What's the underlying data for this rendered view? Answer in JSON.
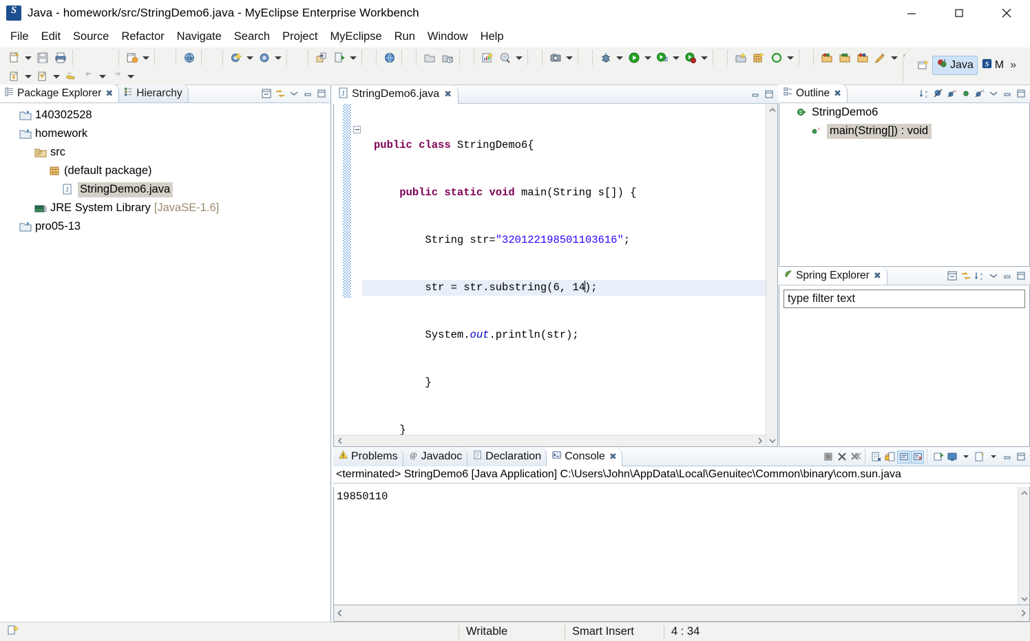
{
  "window": {
    "title": "Java - homework/src/StringDemo6.java - MyEclipse Enterprise Workbench",
    "app_icon": "myeclipse-logo-icon",
    "minimize": "minimize-icon",
    "maximize": "maximize-icon",
    "close": "close-icon"
  },
  "menubar": {
    "items": [
      {
        "label": "File"
      },
      {
        "label": "Edit"
      },
      {
        "label": "Source"
      },
      {
        "label": "Refactor"
      },
      {
        "label": "Navigate"
      },
      {
        "label": "Search"
      },
      {
        "label": "Project"
      },
      {
        "label": "MyEclipse"
      },
      {
        "label": "Run"
      },
      {
        "label": "Window"
      },
      {
        "label": "Help"
      }
    ]
  },
  "perspective": {
    "open_perspective_icon": "open-perspective-icon",
    "items": [
      {
        "label": "Java",
        "icon": "java-perspective-icon",
        "active": true
      },
      {
        "label": "M",
        "icon": "myeclipse-perspective-icon",
        "active": false
      }
    ],
    "overflow": "»"
  },
  "package_explorer": {
    "tabs": [
      {
        "label": "Package Explorer",
        "icon": "package-explorer-icon",
        "active": true,
        "closable": true
      },
      {
        "label": "Hierarchy",
        "icon": "hierarchy-icon",
        "active": false,
        "closable": false
      }
    ],
    "tools": [
      "collapse-all-icon",
      "link-with-editor-icon",
      "view-menu-icon",
      "minimize-icon",
      "maximize-icon"
    ],
    "tree": [
      {
        "label": "140302528",
        "icon": "closed-project-icon",
        "indent": 0,
        "selected": false,
        "suffix": ""
      },
      {
        "label": "homework",
        "icon": "closed-project-icon",
        "indent": 0,
        "selected": false,
        "suffix": ""
      },
      {
        "label": "src",
        "icon": "source-folder-icon",
        "indent": 1,
        "selected": false,
        "suffix": ""
      },
      {
        "label": "(default package)",
        "icon": "package-icon",
        "indent": 2,
        "selected": false,
        "suffix": ""
      },
      {
        "label": "StringDemo6.java",
        "icon": "java-file-icon",
        "indent": 3,
        "selected": true,
        "suffix": ""
      },
      {
        "label": "JRE System Library",
        "icon": "library-icon",
        "indent": 1,
        "selected": false,
        "suffix": "[JavaSE-1.6]"
      },
      {
        "label": "pro05-13",
        "icon": "closed-project-icon",
        "indent": 0,
        "selected": false,
        "suffix": ""
      }
    ]
  },
  "editor": {
    "tab": {
      "label": "StringDemo6.java",
      "icon": "java-file-icon",
      "closable": true
    },
    "tools": [
      "minimize-icon",
      "maximize-icon"
    ],
    "lines": [
      [
        {
          "t": "public class ",
          "c": "kw"
        },
        {
          "t": "StringDemo6{",
          "c": "plain"
        }
      ],
      [
        {
          "t": "    ",
          "c": "plain"
        },
        {
          "t": "public static void ",
          "c": "kw"
        },
        {
          "t": "main(String s[]) {",
          "c": "plain"
        }
      ],
      [
        {
          "t": "        String str=",
          "c": "plain"
        },
        {
          "t": "\"320122198501103616\"",
          "c": "str"
        },
        {
          "t": ";",
          "c": "plain"
        }
      ],
      [
        {
          "t": "        str = str.substring(6, 14",
          "c": "plain"
        },
        {
          "t": "|CARET|",
          "c": "caret"
        },
        {
          "t": ");",
          "c": "plain"
        }
      ],
      [
        {
          "t": "        System.",
          "c": "plain"
        },
        {
          "t": "out",
          "c": "fld"
        },
        {
          "t": ".println(str);",
          "c": "plain"
        }
      ],
      [
        {
          "t": "        }",
          "c": "plain"
        }
      ],
      [
        {
          "t": "    }",
          "c": "plain"
        }
      ]
    ],
    "highlighted_line": 3
  },
  "outline": {
    "tab": {
      "label": "Outline",
      "icon": "outline-icon",
      "closable": true
    },
    "tools": [
      "sort-icon",
      "hide-fields-icon",
      "hide-static-icon",
      "hide-nonpublic-icon",
      "hide-local-types-icon",
      "view-menu-icon",
      "minimize-icon",
      "maximize-icon"
    ],
    "tree": [
      {
        "label": "StringDemo6",
        "icon": "class-icon",
        "indent": 0,
        "selected": false
      },
      {
        "label": "main(String[]) : void",
        "icon": "public-static-method-icon",
        "indent": 1,
        "selected": true
      }
    ]
  },
  "spring_explorer": {
    "tab": {
      "label": "Spring Explorer",
      "icon": "spring-leaf-icon",
      "closable": true
    },
    "tools": [
      "collapse-all-icon",
      "link-with-editor-icon",
      "sort-icon",
      "view-menu-icon",
      "minimize-icon",
      "maximize-icon"
    ],
    "filter": {
      "value": "type filter text",
      "placeholder": "type filter text"
    }
  },
  "console": {
    "tabs": [
      {
        "label": "Problems",
        "icon": "problems-icon",
        "active": false,
        "closable": false
      },
      {
        "label": "Javadoc",
        "icon": "javadoc-icon",
        "active": false,
        "closable": false
      },
      {
        "label": "Declaration",
        "icon": "declaration-icon",
        "active": false,
        "closable": false
      },
      {
        "label": "Console",
        "icon": "console-icon",
        "active": true,
        "closable": true
      }
    ],
    "tools": [
      "terminate-icon",
      "remove-launch-icon",
      "remove-all-launches-icon",
      "clear-console-icon",
      "scroll-lock-icon",
      "word-wrap-icon",
      "show-console-on-output-icon",
      "pin-console-icon",
      "display-selected-console-icon",
      "open-console-icon",
      "minimize-icon",
      "maximize-icon"
    ],
    "header": "<terminated> StringDemo6 [Java Application] C:\\Users\\John\\AppData\\Local\\Genuitec\\Common\\binary\\com.sun.java",
    "output": "19850110"
  },
  "statusbar": {
    "left_icon": "new-element-icon",
    "writable": "Writable",
    "insert_mode": "Smart Insert",
    "position": "4 : 34"
  },
  "toolbar": {
    "groups": [
      {
        "row": 1,
        "buttons": [
          {
            "icon": "new-wizard-icon",
            "dropdown": true
          },
          {
            "icon": "save-icon",
            "dropdown": false
          },
          {
            "icon": "print-icon",
            "dropdown": false
          }
        ]
      },
      {
        "row": 1,
        "buttons": [
          {
            "icon": "new-java-project-icon",
            "dropdown": true
          },
          {
            "icon": "open-type-icon",
            "dropdown": false
          },
          {
            "icon": "new-class-icon",
            "dropdown": true
          },
          {
            "icon": "new-package-icon",
            "dropdown": true
          },
          {
            "icon": "export-icon",
            "dropdown": false
          },
          {
            "icon": "run-external-icon",
            "dropdown": true
          },
          {
            "icon": "web-browser-icon",
            "dropdown": false
          },
          {
            "icon": "deploy-icon",
            "dropdown": false
          },
          {
            "icon": "db-browser-icon",
            "dropdown": false
          },
          {
            "icon": "report-icon",
            "dropdown": false
          },
          {
            "icon": "preview-icon",
            "dropdown": true
          },
          {
            "icon": "snapshot-icon",
            "dropdown": true
          },
          {
            "icon": "debug-icon",
            "dropdown": true
          },
          {
            "icon": "run-icon",
            "dropdown": true
          },
          {
            "icon": "run-config-icon",
            "dropdown": true
          },
          {
            "icon": "coverage-icon",
            "dropdown": true
          },
          {
            "icon": "new-server-icon",
            "dropdown": false
          },
          {
            "icon": "add-module-icon",
            "dropdown": false
          },
          {
            "icon": "refresh-icon",
            "dropdown": true
          },
          {
            "icon": "open-task-icon",
            "dropdown": false
          },
          {
            "icon": "open-task2-icon",
            "dropdown": false
          },
          {
            "icon": "open-task3-icon",
            "dropdown": false
          },
          {
            "icon": "search-ref-icon",
            "dropdown": true
          },
          {
            "icon": "task-repo-icon",
            "dropdown": false
          },
          {
            "icon": "last-edit-icon",
            "dropdown": false
          },
          {
            "icon": "toggle-mark-occurrences-icon",
            "dropdown": false
          },
          {
            "icon": "toggle-block-selection-icon",
            "dropdown": false
          },
          {
            "icon": "show-whitespace-icon",
            "dropdown": false
          }
        ]
      },
      {
        "row": 2,
        "buttons": [
          {
            "icon": "import-icon",
            "dropdown": true
          },
          {
            "icon": "export2-icon",
            "dropdown": true
          },
          {
            "icon": "quick-fix-icon",
            "dropdown": false
          },
          {
            "icon": "back-icon",
            "dropdown": true
          },
          {
            "icon": "forward-icon",
            "dropdown": true
          }
        ]
      }
    ]
  }
}
